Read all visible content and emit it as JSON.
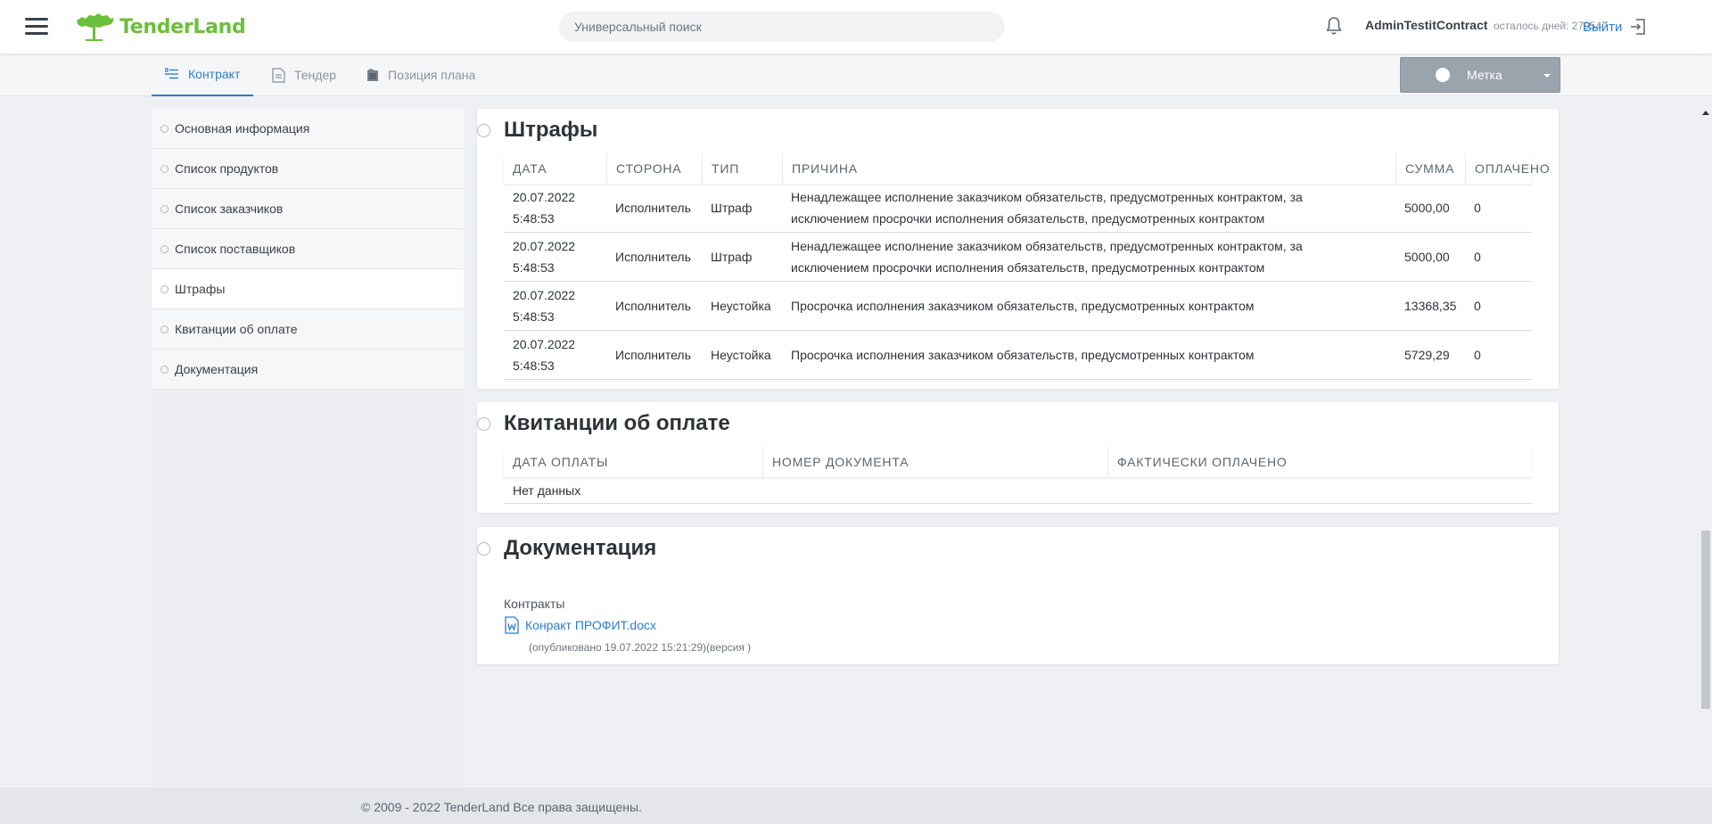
{
  "header": {
    "logo_text": "TenderLand",
    "search_placeholder": "Универсальный поиск",
    "username": "AdminTestitContract",
    "days_left": "осталось дней: 27954",
    "logout_label": "Выйти"
  },
  "tabs": [
    {
      "label": "Контракт",
      "active": true,
      "icon": "list-icon"
    },
    {
      "label": "Тендер",
      "active": false,
      "icon": "document-icon"
    },
    {
      "label": "Позиция плана",
      "active": false,
      "icon": "folder-icon"
    }
  ],
  "mark_button": {
    "label": "Метка"
  },
  "sidebar": {
    "items": [
      {
        "label": "Основная информация",
        "active": false
      },
      {
        "label": "Список продуктов",
        "active": false
      },
      {
        "label": "Список заказчиков",
        "active": false
      },
      {
        "label": "Список поставщиков",
        "active": false
      },
      {
        "label": "Штрафы",
        "active": true
      },
      {
        "label": "Квитанции об оплате",
        "active": false
      },
      {
        "label": "Документация",
        "active": false
      }
    ]
  },
  "fines": {
    "title": "Штрафы",
    "columns": [
      "Дата",
      "Сторона",
      "Тип",
      "Причина",
      "Сумма",
      "Оплачено"
    ],
    "rows": [
      {
        "date": "20.07.2022",
        "time": "5:48:53",
        "side": "Исполнитель",
        "type": "Штраф",
        "reason1": "Ненадлежащее исполнение заказчиком обязательств, предусмотренных контрактом, за",
        "reason2": "исключением просрочки исполнения обязательств, предусмотренных контрактом",
        "sum": "5000,00",
        "paid": "0"
      },
      {
        "date": "20.07.2022",
        "time": "5:48:53",
        "side": "Исполнитель",
        "type": "Штраф",
        "reason1": "Ненадлежащее исполнение заказчиком обязательств, предусмотренных контрактом, за",
        "reason2": "исключением просрочки исполнения обязательств, предусмотренных контрактом",
        "sum": "5000,00",
        "paid": "0"
      },
      {
        "date": "20.07.2022",
        "time": "5:48:53",
        "side": "Исполнитель",
        "type": "Неустойка",
        "reason1": "Просрочка исполнения заказчиком обязательств, предусмотренных контрактом",
        "reason2": "",
        "sum": "13368,35",
        "paid": "0"
      },
      {
        "date": "20.07.2022",
        "time": "5:48:53",
        "side": "Исполнитель",
        "type": "Неустойка",
        "reason1": "Просрочка исполнения заказчиком обязательств, предусмотренных контрактом",
        "reason2": "",
        "sum": "5729,29",
        "paid": "0"
      }
    ]
  },
  "receipts": {
    "title": "Квитанции об оплате",
    "columns": [
      "Дата оплаты",
      "Номер документа",
      "Фактически оплачено"
    ],
    "empty_text": "Нет данных"
  },
  "documents": {
    "title": "Документация",
    "section": "Контракты",
    "file_name": "Конракт ПРОФИТ.docx",
    "file_meta": "(опубликовано 19.07.2022 15:21:29)(версия )"
  },
  "footer": {
    "text": "© 2009 - 2022 TenderLand Все права защищены."
  }
}
